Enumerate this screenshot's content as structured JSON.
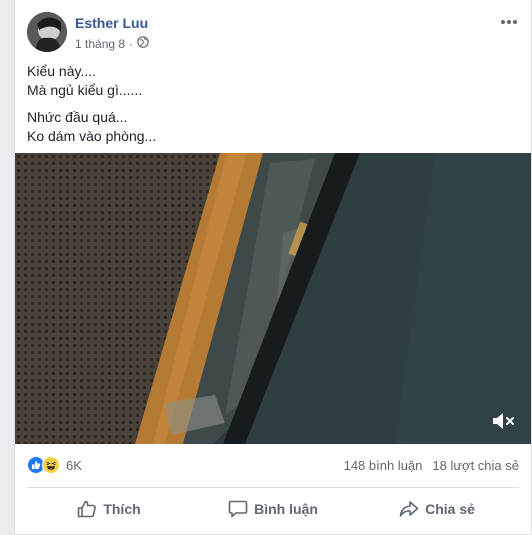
{
  "post": {
    "author": "Esther Luu",
    "date": "1 tháng 8",
    "separator": "·",
    "privacy_icon": "globe-icon",
    "lines": [
      "Kiểu này....",
      "Mà ngủ kiểu gì......",
      "Nhức đầu quá...",
      "Ko dám vào phòng..."
    ]
  },
  "video": {
    "muted": true,
    "mute_icon": "speaker-muted-icon"
  },
  "stats": {
    "reaction_icons": [
      "like-icon",
      "haha-icon"
    ],
    "reaction_count": "6K",
    "comments": "148 bình luận",
    "shares": "18 lượt chia sẻ"
  },
  "actions": {
    "like": "Thích",
    "comment": "Bình luận",
    "share": "Chia sẻ"
  },
  "colors": {
    "author": "#365899",
    "text": "#1d2129",
    "muted": "#606770",
    "like_blue": "#2078f4"
  }
}
